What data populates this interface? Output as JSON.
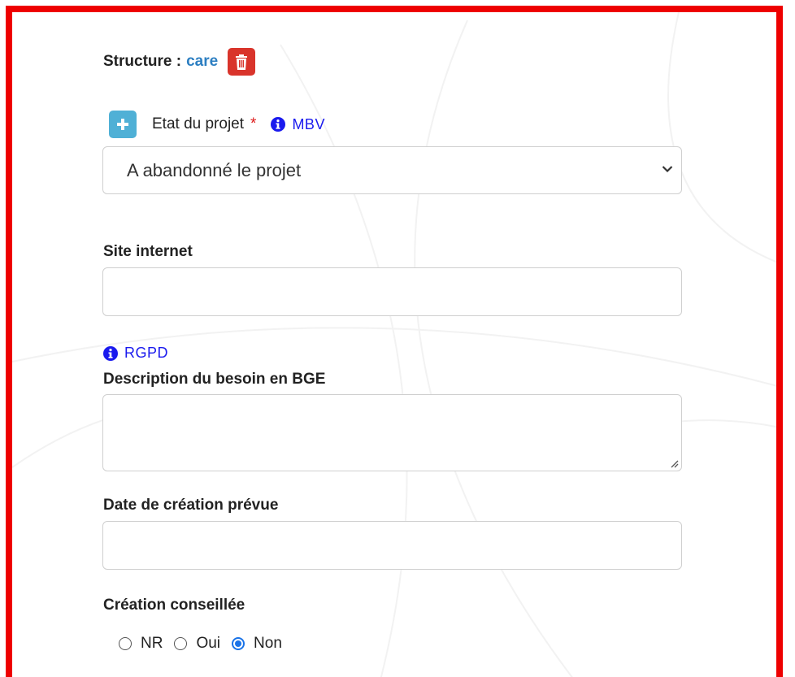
{
  "structure": {
    "label": "Structure :",
    "value": "care"
  },
  "etat": {
    "label": "Etat du projet",
    "required_mark": "*",
    "info_link": "MBV",
    "selected": "A abandonné le projet"
  },
  "site": {
    "label": "Site internet",
    "value": ""
  },
  "rgpd": {
    "info_link": "RGPD"
  },
  "description": {
    "label": "Description du besoin en BGE",
    "value": ""
  },
  "date_creation": {
    "label": "Date de création prévue",
    "value": ""
  },
  "creation_conseillee": {
    "label": "Création conseillée",
    "options": [
      "NR",
      "Oui",
      "Non"
    ],
    "selected": "Non"
  },
  "colors": {
    "frame_border": "#ee0000",
    "link": "#2d7fc2",
    "info_link": "#1a1aee",
    "trash_button": "#d9342b",
    "plus_button": "#4fb0d6",
    "required": "#dd1a1a",
    "radio_selected": "#1a73e8"
  },
  "icons": {
    "delete": "trash-icon",
    "add": "plus-icon",
    "info": "info-circle-icon",
    "select_arrow": "chevron-down-icon",
    "resize": "resize-handle-icon"
  }
}
